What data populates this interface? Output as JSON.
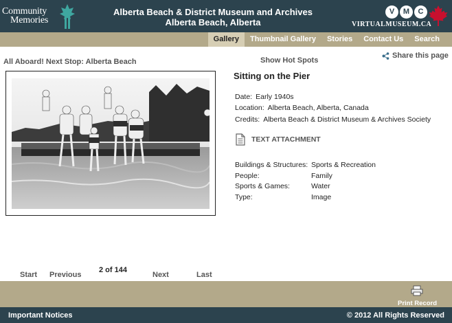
{
  "header": {
    "logo_line1": "Community",
    "logo_line2": "Memories",
    "title_line1": "Alberta Beach & District Museum and Archives",
    "title_line2": "Alberta Beach, Alberta",
    "vm_letters": [
      "V",
      "M",
      "C"
    ],
    "vm_text": "VIRTUALMUSEUM.CA"
  },
  "nav": {
    "items": [
      {
        "label": "Gallery",
        "active": true
      },
      {
        "label": "Thumbnail Gallery"
      },
      {
        "label": "Stories"
      },
      {
        "label": "Contact Us"
      },
      {
        "label": "Search"
      }
    ]
  },
  "toolbar": {
    "story_link": "All Aboard! Next Stop: Alberta Beach",
    "hot_spots": "Show Hot Spots",
    "share": "Share this page"
  },
  "record": {
    "title": "Sitting on the Pier",
    "date_label": "Date:",
    "date_value": "Early 1940s",
    "location_label": "Location:",
    "location_value": "Alberta Beach, Alberta, Canada",
    "credits_label": "Credits:",
    "credits_value": "Alberta Beach & District Museum & Archives Society",
    "attachment_label": "TEXT ATTACHMENT",
    "facets": [
      {
        "key": "Buildings & Structures:",
        "value": "Sports & Recreation"
      },
      {
        "key": "People:",
        "value": "Family"
      },
      {
        "key": "Sports & Games:",
        "value": "Water"
      },
      {
        "key": "Type:",
        "value": "Image"
      }
    ]
  },
  "pager": {
    "start": "Start",
    "previous": "Previous",
    "counter": "2 of 144",
    "next": "Next",
    "last": "Last"
  },
  "footer": {
    "print": "Print Record",
    "notices": "Important Notices",
    "copyright": "© 2012 All Rights Reserved"
  },
  "colors": {
    "header_bg": "#2c434e",
    "band_bg": "#b3a98a",
    "maple_red": "#c8102e",
    "leaf_teal": "#3fa7a0"
  }
}
